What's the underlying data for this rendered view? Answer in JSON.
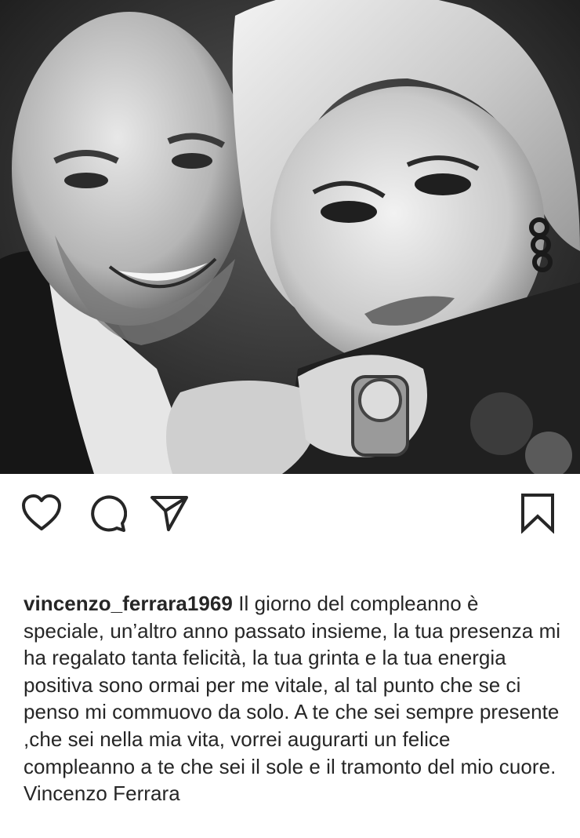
{
  "post": {
    "photo_alt": "",
    "photo_style": "black-and-white"
  },
  "actions": {
    "like_icon": "heart-outline-icon",
    "comment_icon": "comment-bubble-icon",
    "share_icon": "paper-plane-icon",
    "save_icon": "bookmark-outline-icon"
  },
  "caption": {
    "username": "vincenzo_ferrara1969",
    "text": "Il giorno del compleanno è speciale, un’altro anno passato insieme, la tua presenza mi ha regalato tanta felicità, la tua grinta e la tua energia positiva sono ormai per me vitale, al tal punto che se ci penso mi commuovo da solo. A te che sei sempre presente ,che sei nella mia vita, vorrei augurarti un felice compleanno a te che sei il sole e il tramonto del mio cuore. Vincenzo Ferrara"
  },
  "colors": {
    "text": "#262626",
    "icon": "#262626",
    "background": "#ffffff"
  }
}
